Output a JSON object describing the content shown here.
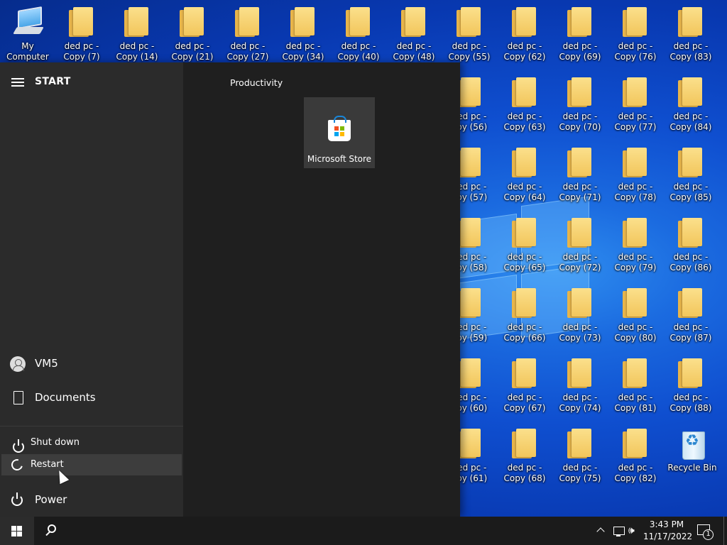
{
  "desktop": {
    "my_computer": "My Computer",
    "recycle_bin": "Recycle Bin",
    "folders": [
      {
        "l1": "ded pc -",
        "l2": "Copy (7)"
      },
      {
        "l1": "ded pc -",
        "l2": "Copy (14)"
      },
      {
        "l1": "ded pc -",
        "l2": "Copy (21)"
      },
      {
        "l1": "ded pc -",
        "l2": "Copy (27)"
      },
      {
        "l1": "ded pc -",
        "l2": "Copy (34)"
      },
      {
        "l1": "ded pc -",
        "l2": "Copy (40)"
      },
      {
        "l1": "ded pc -",
        "l2": "Copy (48)"
      },
      {
        "l1": "ded pc -",
        "l2": "Copy (55)"
      },
      {
        "l1": "ded pc -",
        "l2": "Copy (62)"
      },
      {
        "l1": "ded pc -",
        "l2": "Copy (69)"
      },
      {
        "l1": "ded pc -",
        "l2": "Copy (76)"
      },
      {
        "l1": "ded pc -",
        "l2": "Copy (83)"
      },
      {
        "l1": "ded pc -",
        "l2": "opy (56)"
      },
      {
        "l1": "ded pc -",
        "l2": "Copy (63)"
      },
      {
        "l1": "ded pc -",
        "l2": "Copy (70)"
      },
      {
        "l1": "ded pc -",
        "l2": "Copy (77)"
      },
      {
        "l1": "ded pc -",
        "l2": "Copy (84)"
      },
      {
        "l1": "ded pc -",
        "l2": "opy (57)"
      },
      {
        "l1": "ded pc -",
        "l2": "Copy (64)"
      },
      {
        "l1": "ded pc -",
        "l2": "Copy (71)"
      },
      {
        "l1": "ded pc -",
        "l2": "Copy (78)"
      },
      {
        "l1": "ded pc -",
        "l2": "Copy (85)"
      },
      {
        "l1": "ded pc -",
        "l2": "opy (58)"
      },
      {
        "l1": "ded pc -",
        "l2": "Copy (65)"
      },
      {
        "l1": "ded pc -",
        "l2": "Copy (72)"
      },
      {
        "l1": "ded pc -",
        "l2": "Copy (79)"
      },
      {
        "l1": "ded pc -",
        "l2": "Copy (86)"
      },
      {
        "l1": "ded pc -",
        "l2": "opy (59)"
      },
      {
        "l1": "ded pc -",
        "l2": "Copy (66)"
      },
      {
        "l1": "ded pc -",
        "l2": "Copy (73)"
      },
      {
        "l1": "ded pc -",
        "l2": "Copy (80)"
      },
      {
        "l1": "ded pc -",
        "l2": "Copy (87)"
      },
      {
        "l1": "ded pc -",
        "l2": "opy (60)"
      },
      {
        "l1": "ded pc -",
        "l2": "Copy (67)"
      },
      {
        "l1": "ded pc -",
        "l2": "Copy (74)"
      },
      {
        "l1": "ded pc -",
        "l2": "Copy (81)"
      },
      {
        "l1": "ded pc -",
        "l2": "Copy (88)"
      },
      {
        "l1": "ded pc -",
        "l2": "opy (61)"
      },
      {
        "l1": "ded pc -",
        "l2": "Copy (68)"
      },
      {
        "l1": "ded pc -",
        "l2": "Copy (75)"
      },
      {
        "l1": "ded pc -",
        "l2": "Copy (82)"
      }
    ]
  },
  "start_menu": {
    "title": "START",
    "user": "VM5",
    "documents": "Documents",
    "power": "Power",
    "power_options": {
      "shut_down": "Shut down",
      "restart": "Restart"
    },
    "group_title": "Productivity",
    "tile_store": "Microsoft Store"
  },
  "taskbar": {
    "time": "3:43 PM",
    "date": "11/17/2022",
    "notification_count": "1",
    "volume_icon": "🕪"
  },
  "colors": {
    "accent": "#0f4fd0",
    "menu_bg": "#1f1f1f",
    "menu_left_bg": "#2b2b2b",
    "taskbar_bg": "#1b1b1b"
  }
}
